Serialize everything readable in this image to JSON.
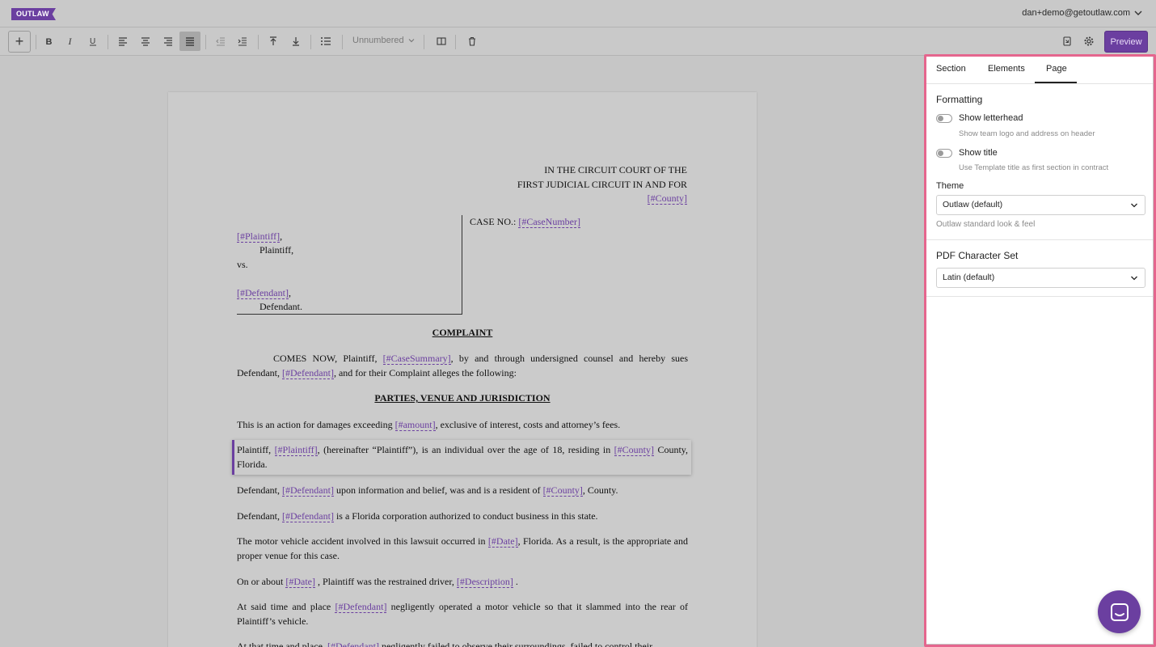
{
  "app": {
    "logo_text": "OUTLAW",
    "user_email": "dan+demo@getoutlaw.com"
  },
  "toolbar": {
    "add_label": "+",
    "numbering_label": "Unnumbered",
    "preview_label": "Preview"
  },
  "document": {
    "court_line1": "IN THE CIRCUIT COURT OF THE",
    "court_line2": "FIRST JUDICIAL CIRCUIT IN AND FOR",
    "court_county": "[#County]",
    "case_no_label": "CASE NO.:",
    "case_number": "[#CaseNumber]",
    "plaintiff_field": "[#Plaintiff]",
    "plaintiff_label": "Plaintiff,",
    "vs": "vs.",
    "defendant_field": "[#Defendant]",
    "defendant_label": "Defendant.",
    "heading_complaint": "COMPLAINT",
    "p1_a": "COMES NOW, Plaintiff,",
    "p1_field1": "[#CaseSummary]",
    "p1_b": ", by and through undersigned counsel and hereby sues Defendant,",
    "p1_field2": "[#Defendant]",
    "p1_c": ", and for their Complaint alleges the following:",
    "heading_parties": "PARTIES, VENUE AND JURISDICTION",
    "p2_a": "This is an action for damages exceeding",
    "p2_field": "[#amount]",
    "p2_b": ", exclusive of interest, costs and attorney’s fees.",
    "p3_a": "Plaintiff,",
    "p3_field1": "[#Plaintiff]",
    "p3_b": ", (hereinafter “Plaintiff”), is an individual over the age of 18, residing in",
    "p3_field2": "[#County]",
    "p3_c": "County, Florida.",
    "p4_a": "Defendant,",
    "p4_field1": "[#Defendant]",
    "p4_b": "upon information and belief, was and is a resident of",
    "p4_field2": "[#County]",
    "p4_c": ", County.",
    "p5_a": "Defendant,",
    "p5_field": "[#Defendant]",
    "p5_b": "is a Florida corporation authorized to conduct business in this state.",
    "p6_a": "The motor vehicle accident involved in this lawsuit occurred in",
    "p6_field": "[#Date]",
    "p6_b": ", Florida. As a result, is the appropriate and proper venue for this case.",
    "p7_a": "On or about",
    "p7_field1": "[#Date]",
    "p7_b": ", Plaintiff was the restrained driver,",
    "p7_field2": "[#Description]",
    "p7_c": ".",
    "p8_a": "At said time and place",
    "p8_field": "[#Defendant]",
    "p8_b": "negligently operated a motor vehicle so that it slammed into the rear of Plaintiff’s vehicle.",
    "p9_a": "At that time and place,",
    "p9_field": "[#Defendant]",
    "p9_b": "negligently failed to observe their surroundings, failed to control their"
  },
  "panel": {
    "tabs": [
      "Section",
      "Elements",
      "Page"
    ],
    "active_tab": "Page",
    "formatting_title": "Formatting",
    "show_letterhead_label": "Show letterhead",
    "show_letterhead_desc": "Show team logo and address on header",
    "show_title_label": "Show title",
    "show_title_desc": "Use Template title as first section in contract",
    "theme_title": "Theme",
    "theme_value": "Outlaw (default)",
    "theme_hint": "Outlaw standard look & feel",
    "pdf_title": "PDF Character Set",
    "pdf_value": "Latin (default)"
  },
  "colors": {
    "brand": "#6b3fa0",
    "highlight_outline": "#e5668e"
  }
}
